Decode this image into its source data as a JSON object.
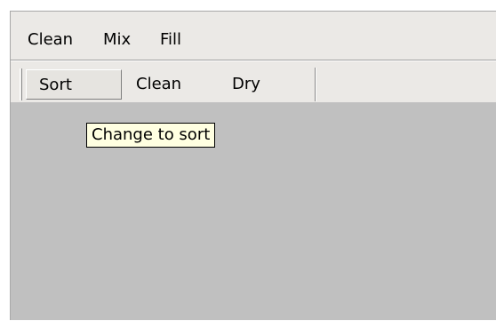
{
  "menubar": {
    "items": [
      {
        "label": "Clean"
      },
      {
        "label": "Mix"
      },
      {
        "label": "Fill"
      }
    ]
  },
  "toolbar": {
    "buttons": [
      {
        "label": "Sort",
        "pressed": true
      },
      {
        "label": "Clean",
        "pressed": false
      },
      {
        "label": "Dry",
        "pressed": false
      }
    ]
  },
  "tooltip": {
    "text": "Change to sort"
  },
  "colors": {
    "content_background": "#c0c0c0",
    "bar_background": "#ebe9e6",
    "tooltip_background": "#ffffe1"
  }
}
